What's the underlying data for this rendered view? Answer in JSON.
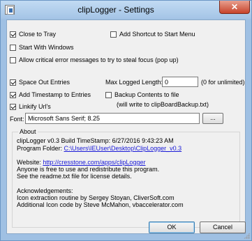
{
  "window": {
    "title": "clipLogger - Settings",
    "close_glyph": "✕"
  },
  "options": {
    "close_to_tray": {
      "label": "Close to Tray",
      "checked": true
    },
    "add_shortcut": {
      "label": "Add Shortcut to Start Menu",
      "checked": false
    },
    "start_with_windows": {
      "label": "Start With Windows",
      "checked": false
    },
    "allow_critical": {
      "label": "Allow critical error messages to try to steal focus (pop up)",
      "checked": false
    },
    "space_out": {
      "label": "Space Out Entries",
      "checked": true
    },
    "add_timestamp": {
      "label": "Add Timestamp to Entries",
      "checked": true
    },
    "linkify": {
      "label": "Linkify Url's",
      "checked": true
    },
    "backup": {
      "label": "Backup Contents to file",
      "checked": false
    },
    "backup_note": "(will write to clipBoardBackup.txt)",
    "max_length_label": "Max Logged Length:",
    "max_length_value": "0",
    "max_length_note": "(0 for unlimited)",
    "font_label": "Font:",
    "font_value": "Microsoft Sans Serif; 8.25",
    "font_browse_label": "..."
  },
  "about": {
    "title": "About",
    "version_line": "clipLogger v0.3    Build TimeStamp: 6/27/2016 9:43:23 AM",
    "program_folder_label": "Program Folder:",
    "program_folder_link": "C:\\Users\\IEUser\\Desktop\\ClipLogger_v0.3",
    "website_label": "Website:",
    "website_link": "http://cresstone.com/apps/clipLogger",
    "free_line": "Anyone is free to use and redistribute this program.",
    "license_line": "See the readme.txt file for license details.",
    "ack_title": "Acknowledgements:",
    "ack_line1": "Icon extraction routine by Sergey Stoyan, CliverSoft.com",
    "ack_line2": "Additional Icon code by Steve McMahon, vbaccelerator.com"
  },
  "buttons": {
    "ok": "OK",
    "cancel": "Cancel"
  },
  "colors": {
    "frame": "#9fc0e3",
    "client": "#f0f0f0",
    "link": "#1a1ad8",
    "close": "#c7432b"
  }
}
